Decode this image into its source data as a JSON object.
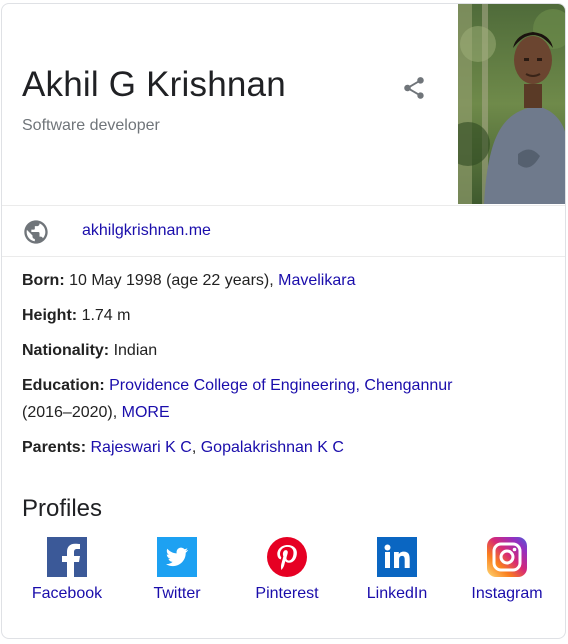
{
  "person": {
    "name": "Akhil G Krishnan",
    "subtitle": "Software developer"
  },
  "website": {
    "label": "akhilgkrishnan.me"
  },
  "facts": {
    "born": {
      "label": "Born:",
      "value": "10 May 1998 (age 22 years), ",
      "link": "Mavelikara"
    },
    "height": {
      "label": "Height:",
      "value": "1.74 m"
    },
    "nationality": {
      "label": "Nationality:",
      "value": "Indian"
    },
    "education": {
      "label": "Education:",
      "link": "Providence College of Engineering, Chengannur",
      "years": "(2016–2020), ",
      "more": "MORE"
    },
    "parents": {
      "label": "Parents:",
      "link1": "Rajeswari K C",
      "sep": ", ",
      "link2": "Gopalakrishnan K C"
    }
  },
  "profiles": {
    "title": "Profiles",
    "items": [
      {
        "label": "Facebook",
        "icon": "facebook-icon",
        "color": "#3b5998"
      },
      {
        "label": "Twitter",
        "icon": "twitter-icon",
        "color": "#1da1f2"
      },
      {
        "label": "Pinterest",
        "icon": "pinterest-icon",
        "color": "#e60023"
      },
      {
        "label": "LinkedIn",
        "icon": "linkedin-icon",
        "color": "#0a66c2"
      },
      {
        "label": "Instagram",
        "icon": "instagram-icon",
        "color": "#c13584"
      }
    ]
  },
  "colors": {
    "link": "#1a0dab",
    "muted": "#70757a"
  }
}
